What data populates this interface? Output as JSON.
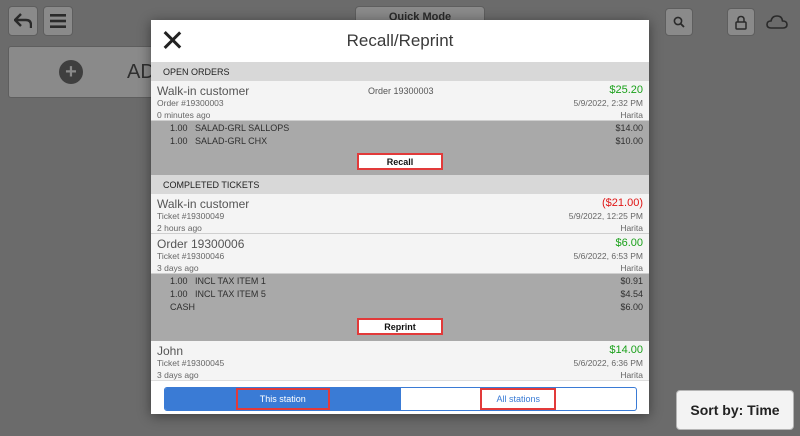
{
  "background": {
    "toolbar": {
      "quick_mode_label": "Quick Mode"
    },
    "add_label": "AD",
    "sort_label": "Sort by: Time"
  },
  "modal": {
    "title": "Recall/Reprint",
    "open_orders_header": "OPEN ORDERS",
    "completed_header": "COMPLETED TICKETS",
    "open_orders": [
      {
        "name": "Walk-in customer",
        "order_ref": "Order 19300003",
        "amount": "$25.20",
        "number": "Order #19300003",
        "date": "5/9/2022, 2:32 PM",
        "ago": "0 minutes ago",
        "employee": "Harita",
        "lines": [
          {
            "qty": "1.00",
            "desc": "SALAD-GRL SALLOPS",
            "price": "$14.00"
          },
          {
            "qty": "1.00",
            "desc": "SALAD-GRL CHX",
            "price": "$10.00"
          }
        ],
        "action_label": "Recall"
      }
    ],
    "completed": [
      {
        "name": "Walk-in customer",
        "amount": "($21.00)",
        "number": "Ticket #19300049",
        "date": "5/9/2022, 12:25 PM",
        "ago": "2 hours ago",
        "employee": "Harita"
      },
      {
        "name": "Order 19300006",
        "amount": "$6.00",
        "number": "Ticket #19300046",
        "date": "5/6/2022, 6:53 PM",
        "ago": "3 days ago",
        "employee": "Harita",
        "lines": [
          {
            "qty": "1.00",
            "desc": "INCL TAX ITEM 1",
            "price": "$0.91"
          },
          {
            "qty": "1.00",
            "desc": "INCL TAX ITEM 5",
            "price": "$4.54"
          },
          {
            "qty": "",
            "desc": "CASH",
            "price": "$6.00"
          }
        ],
        "action_label": "Reprint"
      },
      {
        "name": "John",
        "amount": "$14.00",
        "number": "Ticket #19300045",
        "date": "5/6/2022, 6:36 PM",
        "ago": "3 days ago",
        "employee": "Harita"
      }
    ],
    "footer": {
      "this_station": "This station",
      "all_stations": "All stations"
    }
  },
  "colors": {
    "positive_amount": "#1ba11b",
    "negative_amount": "#e01515",
    "accent": "#3a7bd5",
    "highlight": "#e23a3a"
  }
}
